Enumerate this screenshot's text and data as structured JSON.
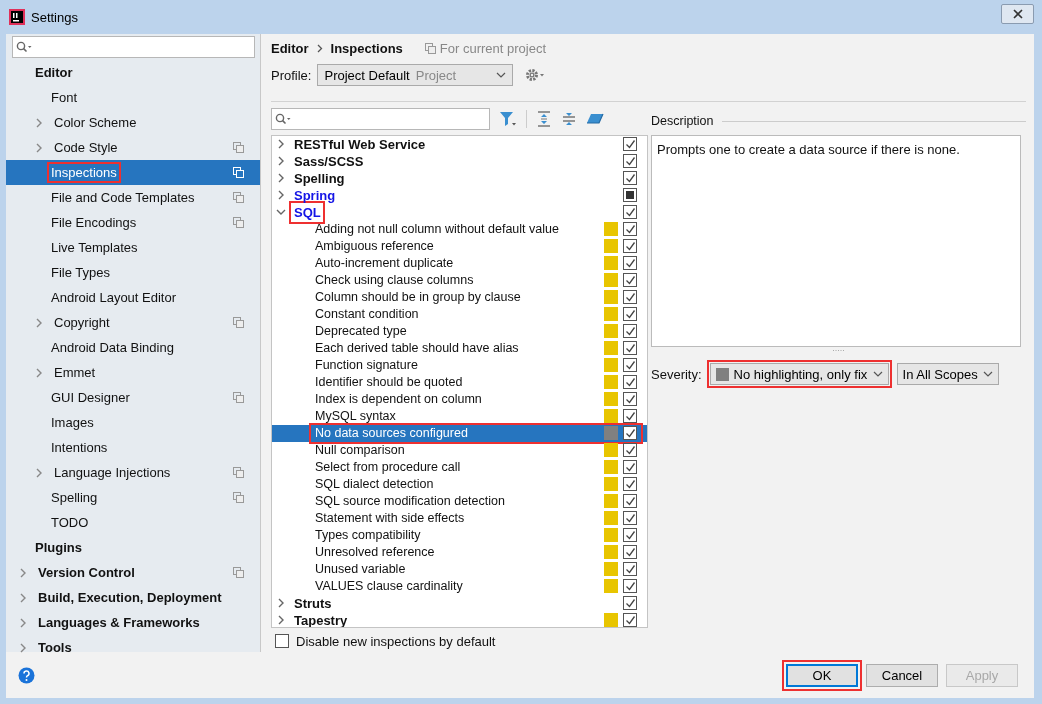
{
  "window": {
    "title": "Settings"
  },
  "sidebar": {
    "items": [
      {
        "label": "Editor",
        "expandable": false,
        "shared": false,
        "selected": false,
        "annotated": false,
        "children": [
          {
            "label": "Font",
            "expandable": false,
            "shared": false,
            "selected": false,
            "annotated": false
          },
          {
            "label": "Color Scheme",
            "expandable": true,
            "shared": false,
            "selected": false,
            "annotated": false
          },
          {
            "label": "Code Style",
            "expandable": true,
            "shared": true,
            "selected": false,
            "annotated": false
          },
          {
            "label": "Inspections",
            "expandable": false,
            "shared": true,
            "selected": true,
            "annotated": true
          },
          {
            "label": "File and Code Templates",
            "expandable": false,
            "shared": true,
            "selected": false,
            "annotated": false
          },
          {
            "label": "File Encodings",
            "expandable": false,
            "shared": true,
            "selected": false,
            "annotated": false
          },
          {
            "label": "Live Templates",
            "expandable": false,
            "shared": false,
            "selected": false,
            "annotated": false
          },
          {
            "label": "File Types",
            "expandable": false,
            "shared": false,
            "selected": false,
            "annotated": false
          },
          {
            "label": "Android Layout Editor",
            "expandable": false,
            "shared": false,
            "selected": false,
            "annotated": false
          },
          {
            "label": "Copyright",
            "expandable": true,
            "shared": true,
            "selected": false,
            "annotated": false
          },
          {
            "label": "Android Data Binding",
            "expandable": false,
            "shared": false,
            "selected": false,
            "annotated": false
          },
          {
            "label": "Emmet",
            "expandable": true,
            "shared": false,
            "selected": false,
            "annotated": false
          },
          {
            "label": "GUI Designer",
            "expandable": false,
            "shared": true,
            "selected": false,
            "annotated": false
          },
          {
            "label": "Images",
            "expandable": false,
            "shared": false,
            "selected": false,
            "annotated": false
          },
          {
            "label": "Intentions",
            "expandable": false,
            "shared": false,
            "selected": false,
            "annotated": false
          },
          {
            "label": "Language Injections",
            "expandable": true,
            "shared": true,
            "selected": false,
            "annotated": false
          },
          {
            "label": "Spelling",
            "expandable": false,
            "shared": true,
            "selected": false,
            "annotated": false
          },
          {
            "label": "TODO",
            "expandable": false,
            "shared": false,
            "selected": false,
            "annotated": false
          }
        ]
      },
      {
        "label": "Plugins",
        "expandable": false,
        "shared": false,
        "selected": false,
        "annotated": false
      },
      {
        "label": "Version Control",
        "expandable": true,
        "shared": true,
        "selected": false,
        "annotated": false
      },
      {
        "label": "Build, Execution, Deployment",
        "expandable": true,
        "shared": false,
        "selected": false,
        "annotated": false
      },
      {
        "label": "Languages & Frameworks",
        "expandable": true,
        "shared": false,
        "selected": false,
        "annotated": false
      },
      {
        "label": "Tools",
        "expandable": true,
        "shared": false,
        "selected": false,
        "annotated": false
      }
    ]
  },
  "breadcrumb": [
    "Editor",
    "Inspections"
  ],
  "scope_note": "For current project",
  "profile": {
    "label": "Profile:",
    "value": "Project Default",
    "hint": "Project"
  },
  "inspections": [
    {
      "label": "RESTful Web Service",
      "expanded": false,
      "modified": false,
      "checked": true,
      "annotated": false
    },
    {
      "label": "Sass/SCSS",
      "expanded": false,
      "modified": false,
      "checked": true,
      "annotated": false
    },
    {
      "label": "Spelling",
      "expanded": false,
      "modified": false,
      "checked": true,
      "annotated": false
    },
    {
      "label": "Spring",
      "expanded": false,
      "modified": true,
      "checked": false,
      "mixed": true,
      "annotated": false
    },
    {
      "label": "SQL",
      "expanded": true,
      "modified": true,
      "checked": true,
      "annotated": true,
      "children": [
        {
          "label": "Adding not null column without default value",
          "color": "#e8c500",
          "checked": true,
          "selected": false,
          "annotated": false
        },
        {
          "label": "Ambiguous reference",
          "color": "#e8c500",
          "checked": true,
          "selected": false,
          "annotated": false
        },
        {
          "label": "Auto-increment duplicate",
          "color": "#e8c500",
          "checked": true,
          "selected": false,
          "annotated": false
        },
        {
          "label": "Check using clause columns",
          "color": "#e8c500",
          "checked": true,
          "selected": false,
          "annotated": false
        },
        {
          "label": "Column should be in group by clause",
          "color": "#e8c500",
          "checked": true,
          "selected": false,
          "annotated": false
        },
        {
          "label": "Constant condition",
          "color": "#e8c500",
          "checked": true,
          "selected": false,
          "annotated": false
        },
        {
          "label": "Deprecated type",
          "color": "#e8c500",
          "checked": true,
          "selected": false,
          "annotated": false
        },
        {
          "label": "Each derived table should have alias",
          "color": "#e8c500",
          "checked": true,
          "selected": false,
          "annotated": false
        },
        {
          "label": "Function signature",
          "color": "#e8c500",
          "checked": true,
          "selected": false,
          "annotated": false
        },
        {
          "label": "Identifier should be quoted",
          "color": "#e8c500",
          "checked": true,
          "selected": false,
          "annotated": false
        },
        {
          "label": "Index is dependent on column",
          "color": "#e8c500",
          "checked": true,
          "selected": false,
          "annotated": false
        },
        {
          "label": "MySQL syntax",
          "color": "#e8c500",
          "checked": true,
          "selected": false,
          "annotated": false
        },
        {
          "label": "No data sources configured",
          "color": "#808080",
          "checked": true,
          "selected": true,
          "annotated": true
        },
        {
          "label": "Null comparison",
          "color": "#e8c500",
          "checked": true,
          "selected": false,
          "annotated": false
        },
        {
          "label": "Select from procedure call",
          "color": "#e8c500",
          "checked": true,
          "selected": false,
          "annotated": false
        },
        {
          "label": "SQL dialect detection",
          "color": "#e8c500",
          "checked": true,
          "selected": false,
          "annotated": false
        },
        {
          "label": "SQL source modification detection",
          "color": "#e8c500",
          "checked": true,
          "selected": false,
          "annotated": false
        },
        {
          "label": "Statement with side effects",
          "color": "#e8c500",
          "checked": true,
          "selected": false,
          "annotated": false
        },
        {
          "label": "Types compatibility",
          "color": "#e8c500",
          "checked": true,
          "selected": false,
          "annotated": false
        },
        {
          "label": "Unresolved reference",
          "color": "#e8c500",
          "checked": true,
          "selected": false,
          "annotated": false
        },
        {
          "label": "Unused variable",
          "color": "#e8c500",
          "checked": true,
          "selected": false,
          "annotated": false
        },
        {
          "label": "VALUES clause cardinality",
          "color": "#e8c500",
          "checked": true,
          "selected": false,
          "annotated": false
        }
      ]
    },
    {
      "label": "Struts",
      "expanded": false,
      "modified": false,
      "checked": true,
      "annotated": false
    },
    {
      "label": "Tapestry",
      "expanded": false,
      "modified": false,
      "checked": true,
      "color": "#e8c500",
      "annotated": false
    }
  ],
  "disable_new": {
    "label": "Disable new inspections by default",
    "checked": false
  },
  "description": {
    "title": "Description",
    "text": "Prompts one to create a data source if there is none."
  },
  "severity": {
    "label": "Severity:",
    "value": "No highlighting, only fix",
    "color": "#808080",
    "annotated": true
  },
  "scope": {
    "value": "In All Scopes"
  },
  "buttons": [
    {
      "label": "OK",
      "kind": "default",
      "disabled": false,
      "annotated": true
    },
    {
      "label": "Cancel",
      "kind": "normal",
      "disabled": false,
      "annotated": false
    },
    {
      "label": "Apply",
      "kind": "normal",
      "disabled": true,
      "annotated": false
    }
  ]
}
